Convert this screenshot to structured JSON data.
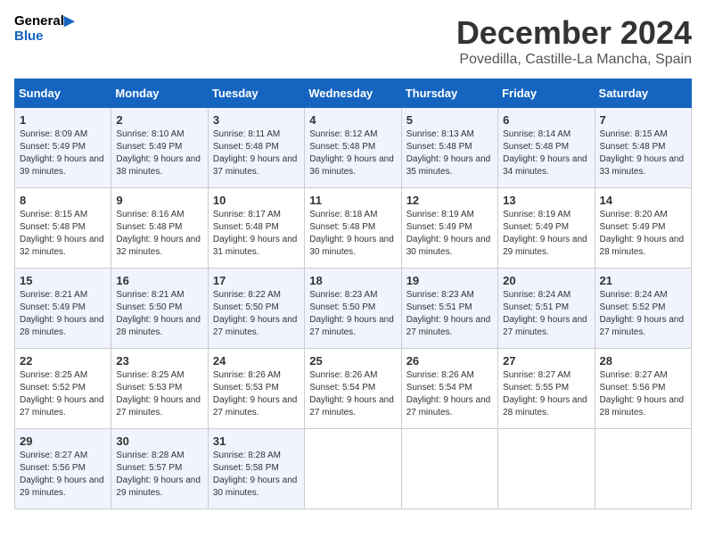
{
  "logo": {
    "line1": "General",
    "line2": "Blue"
  },
  "title": "December 2024",
  "subtitle": "Povedilla, Castille-La Mancha, Spain",
  "days_header": [
    "Sunday",
    "Monday",
    "Tuesday",
    "Wednesday",
    "Thursday",
    "Friday",
    "Saturday"
  ],
  "weeks": [
    [
      {
        "day": "1",
        "sunrise": "Sunrise: 8:09 AM",
        "sunset": "Sunset: 5:49 PM",
        "daylight": "Daylight: 9 hours and 39 minutes."
      },
      {
        "day": "2",
        "sunrise": "Sunrise: 8:10 AM",
        "sunset": "Sunset: 5:49 PM",
        "daylight": "Daylight: 9 hours and 38 minutes."
      },
      {
        "day": "3",
        "sunrise": "Sunrise: 8:11 AM",
        "sunset": "Sunset: 5:48 PM",
        "daylight": "Daylight: 9 hours and 37 minutes."
      },
      {
        "day": "4",
        "sunrise": "Sunrise: 8:12 AM",
        "sunset": "Sunset: 5:48 PM",
        "daylight": "Daylight: 9 hours and 36 minutes."
      },
      {
        "day": "5",
        "sunrise": "Sunrise: 8:13 AM",
        "sunset": "Sunset: 5:48 PM",
        "daylight": "Daylight: 9 hours and 35 minutes."
      },
      {
        "day": "6",
        "sunrise": "Sunrise: 8:14 AM",
        "sunset": "Sunset: 5:48 PM",
        "daylight": "Daylight: 9 hours and 34 minutes."
      },
      {
        "day": "7",
        "sunrise": "Sunrise: 8:15 AM",
        "sunset": "Sunset: 5:48 PM",
        "daylight": "Daylight: 9 hours and 33 minutes."
      }
    ],
    [
      {
        "day": "8",
        "sunrise": "Sunrise: 8:15 AM",
        "sunset": "Sunset: 5:48 PM",
        "daylight": "Daylight: 9 hours and 32 minutes."
      },
      {
        "day": "9",
        "sunrise": "Sunrise: 8:16 AM",
        "sunset": "Sunset: 5:48 PM",
        "daylight": "Daylight: 9 hours and 32 minutes."
      },
      {
        "day": "10",
        "sunrise": "Sunrise: 8:17 AM",
        "sunset": "Sunset: 5:48 PM",
        "daylight": "Daylight: 9 hours and 31 minutes."
      },
      {
        "day": "11",
        "sunrise": "Sunrise: 8:18 AM",
        "sunset": "Sunset: 5:48 PM",
        "daylight": "Daylight: 9 hours and 30 minutes."
      },
      {
        "day": "12",
        "sunrise": "Sunrise: 8:19 AM",
        "sunset": "Sunset: 5:49 PM",
        "daylight": "Daylight: 9 hours and 30 minutes."
      },
      {
        "day": "13",
        "sunrise": "Sunrise: 8:19 AM",
        "sunset": "Sunset: 5:49 PM",
        "daylight": "Daylight: 9 hours and 29 minutes."
      },
      {
        "day": "14",
        "sunrise": "Sunrise: 8:20 AM",
        "sunset": "Sunset: 5:49 PM",
        "daylight": "Daylight: 9 hours and 28 minutes."
      }
    ],
    [
      {
        "day": "15",
        "sunrise": "Sunrise: 8:21 AM",
        "sunset": "Sunset: 5:49 PM",
        "daylight": "Daylight: 9 hours and 28 minutes."
      },
      {
        "day": "16",
        "sunrise": "Sunrise: 8:21 AM",
        "sunset": "Sunset: 5:50 PM",
        "daylight": "Daylight: 9 hours and 28 minutes."
      },
      {
        "day": "17",
        "sunrise": "Sunrise: 8:22 AM",
        "sunset": "Sunset: 5:50 PM",
        "daylight": "Daylight: 9 hours and 27 minutes."
      },
      {
        "day": "18",
        "sunrise": "Sunrise: 8:23 AM",
        "sunset": "Sunset: 5:50 PM",
        "daylight": "Daylight: 9 hours and 27 minutes."
      },
      {
        "day": "19",
        "sunrise": "Sunrise: 8:23 AM",
        "sunset": "Sunset: 5:51 PM",
        "daylight": "Daylight: 9 hours and 27 minutes."
      },
      {
        "day": "20",
        "sunrise": "Sunrise: 8:24 AM",
        "sunset": "Sunset: 5:51 PM",
        "daylight": "Daylight: 9 hours and 27 minutes."
      },
      {
        "day": "21",
        "sunrise": "Sunrise: 8:24 AM",
        "sunset": "Sunset: 5:52 PM",
        "daylight": "Daylight: 9 hours and 27 minutes."
      }
    ],
    [
      {
        "day": "22",
        "sunrise": "Sunrise: 8:25 AM",
        "sunset": "Sunset: 5:52 PM",
        "daylight": "Daylight: 9 hours and 27 minutes."
      },
      {
        "day": "23",
        "sunrise": "Sunrise: 8:25 AM",
        "sunset": "Sunset: 5:53 PM",
        "daylight": "Daylight: 9 hours and 27 minutes."
      },
      {
        "day": "24",
        "sunrise": "Sunrise: 8:26 AM",
        "sunset": "Sunset: 5:53 PM",
        "daylight": "Daylight: 9 hours and 27 minutes."
      },
      {
        "day": "25",
        "sunrise": "Sunrise: 8:26 AM",
        "sunset": "Sunset: 5:54 PM",
        "daylight": "Daylight: 9 hours and 27 minutes."
      },
      {
        "day": "26",
        "sunrise": "Sunrise: 8:26 AM",
        "sunset": "Sunset: 5:54 PM",
        "daylight": "Daylight: 9 hours and 27 minutes."
      },
      {
        "day": "27",
        "sunrise": "Sunrise: 8:27 AM",
        "sunset": "Sunset: 5:55 PM",
        "daylight": "Daylight: 9 hours and 28 minutes."
      },
      {
        "day": "28",
        "sunrise": "Sunrise: 8:27 AM",
        "sunset": "Sunset: 5:56 PM",
        "daylight": "Daylight: 9 hours and 28 minutes."
      }
    ],
    [
      {
        "day": "29",
        "sunrise": "Sunrise: 8:27 AM",
        "sunset": "Sunset: 5:56 PM",
        "daylight": "Daylight: 9 hours and 29 minutes."
      },
      {
        "day": "30",
        "sunrise": "Sunrise: 8:28 AM",
        "sunset": "Sunset: 5:57 PM",
        "daylight": "Daylight: 9 hours and 29 minutes."
      },
      {
        "day": "31",
        "sunrise": "Sunrise: 8:28 AM",
        "sunset": "Sunset: 5:58 PM",
        "daylight": "Daylight: 9 hours and 30 minutes."
      },
      null,
      null,
      null,
      null
    ]
  ]
}
